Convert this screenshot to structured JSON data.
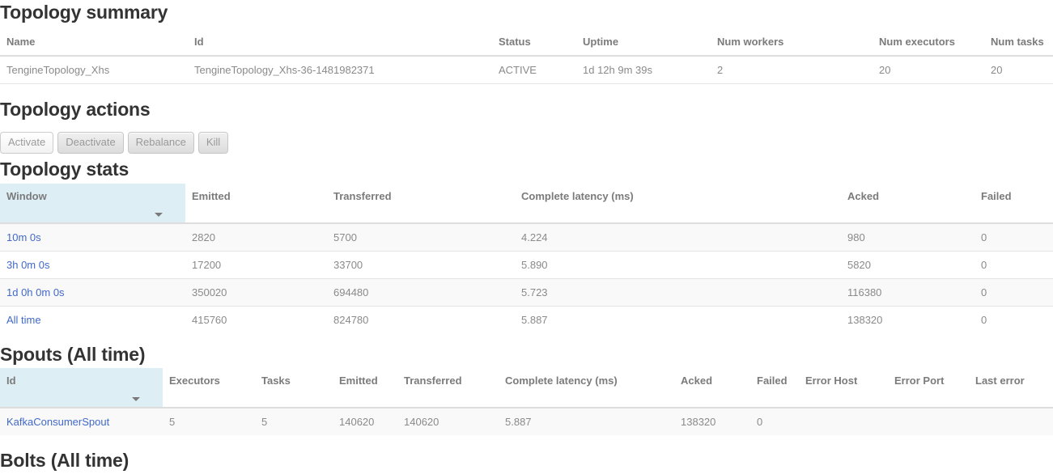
{
  "sections": {
    "topology_summary": {
      "title": "Topology summary",
      "columns": [
        "Name",
        "Id",
        "Status",
        "Uptime",
        "Num workers",
        "Num executors",
        "Num tasks"
      ],
      "rows": [
        {
          "name": "TengineTopology_Xhs",
          "id": "TengineTopology_Xhs-36-1481982371",
          "status": "ACTIVE",
          "uptime": "1d 12h 9m 39s",
          "num_workers": "2",
          "num_executors": "20",
          "num_tasks": "20"
        }
      ]
    },
    "topology_actions": {
      "title": "Topology actions",
      "buttons": [
        {
          "label": "Activate",
          "state": "disabled"
        },
        {
          "label": "Deactivate",
          "state": "enabled"
        },
        {
          "label": "Rebalance",
          "state": "enabled"
        },
        {
          "label": "Kill",
          "state": "enabled"
        }
      ]
    },
    "topology_stats": {
      "title": "Topology stats",
      "columns": [
        "Window",
        "Emitted",
        "Transferred",
        "Complete latency (ms)",
        "Acked",
        "Failed"
      ],
      "sorted_column": "Window",
      "rows": [
        {
          "window": "10m 0s",
          "emitted": "2820",
          "transferred": "5700",
          "complete_latency": "4.224",
          "acked": "980",
          "failed": "0"
        },
        {
          "window": "3h 0m 0s",
          "emitted": "17200",
          "transferred": "33700",
          "complete_latency": "5.890",
          "acked": "5820",
          "failed": "0"
        },
        {
          "window": "1d 0h 0m 0s",
          "emitted": "350020",
          "transferred": "694480",
          "complete_latency": "5.723",
          "acked": "116380",
          "failed": "0"
        },
        {
          "window": "All time",
          "emitted": "415760",
          "transferred": "824780",
          "complete_latency": "5.887",
          "acked": "138320",
          "failed": "0"
        }
      ]
    },
    "spouts": {
      "title": "Spouts (All time)",
      "columns": [
        "Id",
        "Executors",
        "Tasks",
        "Emitted",
        "Transferred",
        "Complete latency (ms)",
        "Acked",
        "Failed",
        "Error Host",
        "Error Port",
        "Last error"
      ],
      "sorted_column": "Id",
      "rows": [
        {
          "id": "KafkaConsumerSpout",
          "executors": "5",
          "tasks": "5",
          "emitted": "140620",
          "transferred": "140620",
          "complete_latency": "5.887",
          "acked": "138320",
          "failed": "0",
          "error_host": "",
          "error_port": "",
          "last_error": ""
        }
      ]
    },
    "bolts": {
      "title": "Bolts (All time)"
    }
  },
  "colors": {
    "link": "#4169c9",
    "sorted_header_bg": "#ddeef5",
    "text": "#8a8a8a",
    "heading": "#333333"
  }
}
